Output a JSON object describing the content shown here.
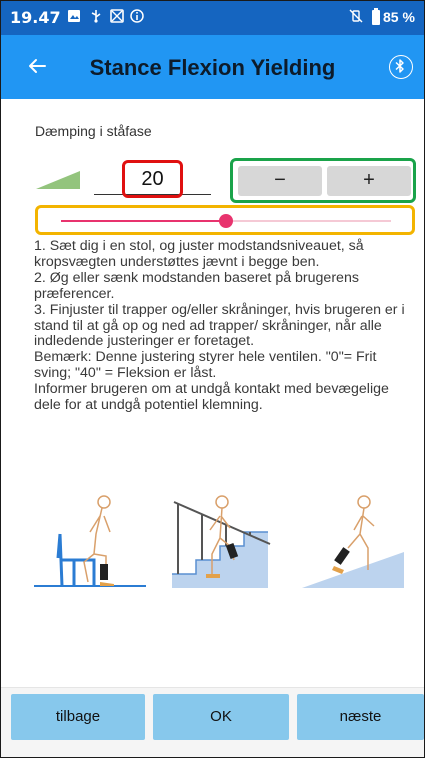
{
  "status_bar": {
    "time": "19.47",
    "battery": "85 %"
  },
  "app_bar": {
    "title": "Stance Flexion Yielding"
  },
  "setting": {
    "label": "Dæmping i ståfase",
    "value": "20",
    "minus_label": "−",
    "plus_label": "+",
    "slider_fraction": 0.5
  },
  "instructions": [
    "1. Sæt dig i en stol, og juster modstandsniveauet, så kropsvægten understøttes jævnt i begge ben.",
    "2. Øg eller sænk modstanden baseret på brugerens præferencer.",
    "3. Finjuster til trapper og/eller skråninger, hvis brugeren er i stand til at gå op og ned ad trapper/ skråninger, når alle indledende justeringer er foretaget.",
    "Bemærk: Denne justering styrer hele ventilen. \"0\"= Frit sving; \"40\" = Fleksion er låst.",
    "Informer brugeren om at undgå kontakt med bevægelige dele for at undgå potentiel klemning."
  ],
  "illustrations": [
    "chair-sitting-figure",
    "stairs-figure",
    "slope-figure"
  ],
  "bottom_nav": {
    "back_label": "tilbage",
    "ok_label": "OK",
    "next_label": "næste"
  },
  "colors": {
    "status_bar": "#1565c0",
    "app_bar": "#2196f3",
    "slider": "#e8336e",
    "nav_button": "#87c8ec"
  }
}
